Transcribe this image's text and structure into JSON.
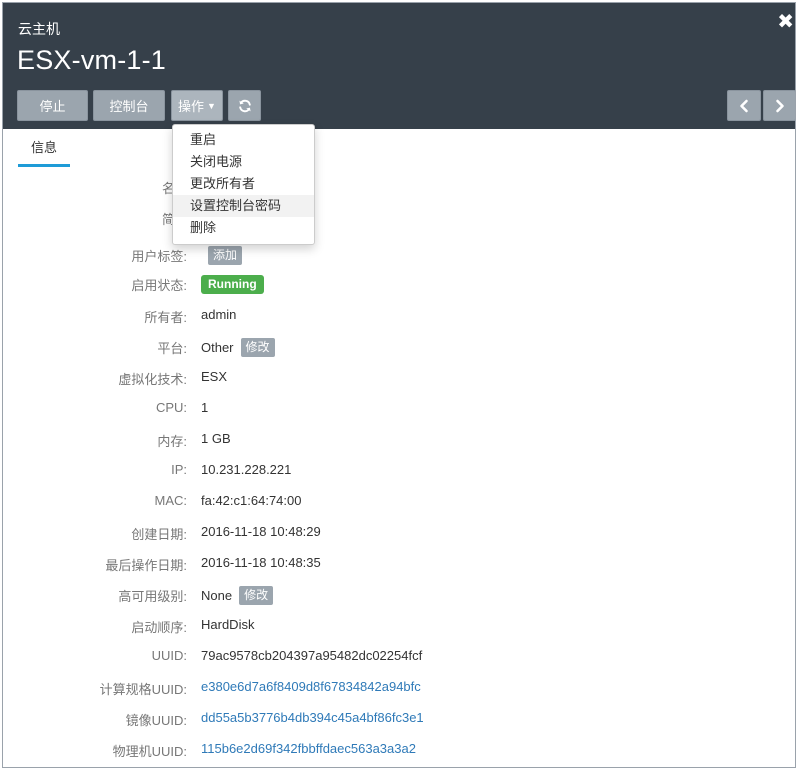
{
  "header": {
    "subtitle": "云主机",
    "title": "ESX-vm-1-1",
    "buttons": {
      "stop": "停止",
      "console": "控制台",
      "operations": "操作"
    },
    "close_icon": "close-icon",
    "refresh_icon": "refresh-icon",
    "prev_icon": "chevron-left-icon",
    "next_icon": "chevron-right-icon"
  },
  "tabs": [
    {
      "label": "信息"
    }
  ],
  "operations_menu": {
    "items": [
      {
        "label": "重启"
      },
      {
        "label": "关闭电源"
      },
      {
        "label": "更改所有者"
      },
      {
        "label": "设置控制台密码"
      },
      {
        "label": "删除"
      }
    ],
    "hovered_index": 3
  },
  "details": {
    "name_label": "名",
    "desc_label": "简",
    "user_tags": {
      "label": "用户标签:",
      "action": "添加"
    },
    "state": {
      "label": "启用状态:",
      "value": "Running"
    },
    "owner": {
      "label": "所有者:",
      "value": "admin"
    },
    "platform": {
      "label": "平台:",
      "value": "Other",
      "action": "修改"
    },
    "hypervisor": {
      "label": "虚拟化技术:",
      "value": "ESX"
    },
    "cpu": {
      "label": "CPU:",
      "value": "1"
    },
    "memory": {
      "label": "内存:",
      "value": "1 GB"
    },
    "ip": {
      "label": "IP:",
      "value": "10.231.228.221"
    },
    "mac": {
      "label": "MAC:",
      "value": "fa:42:c1:64:74:00"
    },
    "created": {
      "label": "创建日期:",
      "value": "2016-11-18 10:48:29"
    },
    "last_op": {
      "label": "最后操作日期:",
      "value": "2016-11-18 10:48:35"
    },
    "ha_level": {
      "label": "高可用级别:",
      "value": "None",
      "action": "修改"
    },
    "boot_order": {
      "label": "启动顺序:",
      "value": "HardDisk"
    },
    "uuid": {
      "label": "UUID:",
      "value": "79ac9578cb204397a95482dc02254fcf"
    },
    "instance_offering_uuid": {
      "label": "计算规格UUID:",
      "value": "e380e6d7a6f8409d8f67834842a94bfc"
    },
    "image_uuid": {
      "label": "镜像UUID:",
      "value": "dd55a5b3776b4db394c45a4bf86fc3e1"
    },
    "host_uuid": {
      "label": "物理机UUID:",
      "value": "115b6e2d69f342fbbffdaec563a3a3a2"
    }
  },
  "colors": {
    "header_bg": "#36404a",
    "button_bg": "#9ba5ae",
    "accent": "#1e9bd7",
    "running": "#4cae4c",
    "link": "#2f7ab8"
  }
}
